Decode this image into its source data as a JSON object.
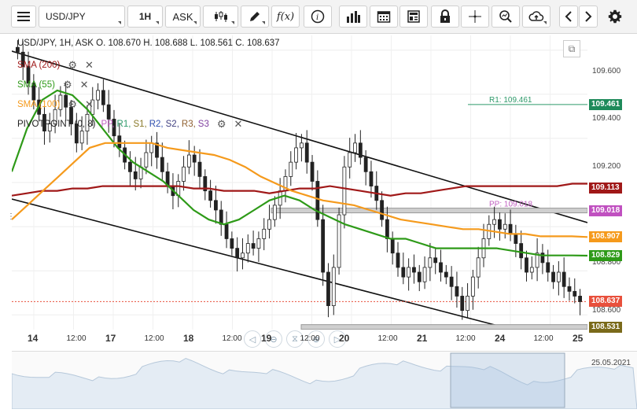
{
  "toolbar": {
    "menu_icon": "hamburger-icon",
    "symbol": "USD/JPY",
    "timeframe": "1H",
    "price_type": "ASK",
    "buttons": [
      "candles-icon",
      "draw-pencil-icon",
      "function-icon",
      "info-icon",
      "volume-bars-icon",
      "calendar-icon",
      "news-icon",
      "lock-icon",
      "crosshair-icon",
      "zoom-icon",
      "cloud-upload-icon",
      "prev-arrow-icon",
      "next-arrow-icon",
      "settings-gear-icon"
    ]
  },
  "legend": {
    "header": "USD/JPY, 1H, ASK   O. 108.670 H. 108.688 L. 108.561 C. 108.637",
    "indicators": [
      {
        "label": "SMA (200)",
        "color": "#a01818"
      },
      {
        "label": "SMA (55)",
        "color": "#2e9a18"
      },
      {
        "label": "SMA (100)",
        "color": "#f59a1c"
      }
    ],
    "pivot": {
      "prefix": "PIVOTPOINT (0, 8)",
      "words": [
        {
          "text": "PP,",
          "color": "#c060c0"
        },
        {
          "text": "R1,",
          "color": "#2e9a6a"
        },
        {
          "text": "S1,",
          "color": "#8a7a2a"
        },
        {
          "text": "R2,",
          "color": "#3050b0"
        },
        {
          "text": "S2,",
          "color": "#404080"
        },
        {
          "text": "R3,",
          "color": "#906030"
        },
        {
          "text": "S3",
          "color": "#8040a0"
        }
      ]
    }
  },
  "y_axis": {
    "ticks": [
      "109.600",
      "109.400",
      "109.200",
      "108.800",
      "108.600"
    ]
  },
  "price_tags": [
    {
      "label": "109.461",
      "color": "#1e8a5a",
      "price": 109.461
    },
    {
      "label": "109.113",
      "color": "#a01818",
      "price": 109.113
    },
    {
      "label": "109.018",
      "color": "#c050c0",
      "price": 109.018
    },
    {
      "label": "108.907",
      "color": "#f59a1c",
      "price": 108.907
    },
    {
      "label": "108.829",
      "color": "#2e9a18",
      "price": 108.829
    },
    {
      "label": "108.637",
      "color": "#e8503c",
      "price": 108.637
    },
    {
      "label": "108.531",
      "color": "#7a6a1a",
      "price": 108.531
    }
  ],
  "line_labels": {
    "r1": "R1: 109.461",
    "pp": "PP: 109.018",
    "s1": "S1: 108.531"
  },
  "x_axis": {
    "labels": [
      {
        "text": "14",
        "big": true
      },
      {
        "text": "12:00",
        "big": false
      },
      {
        "text": "17",
        "big": true
      },
      {
        "text": "12:00",
        "big": false
      },
      {
        "text": "18",
        "big": true
      },
      {
        "text": "12:00",
        "big": false
      },
      {
        "text": "19",
        "big": true
      },
      {
        "text": "12:00",
        "big": false
      },
      {
        "text": "20",
        "big": true
      },
      {
        "text": "12:00",
        "big": false
      },
      {
        "text": "21",
        "big": true
      },
      {
        "text": "12:00",
        "big": false
      },
      {
        "text": "24",
        "big": true
      },
      {
        "text": "12:00",
        "big": false
      },
      {
        "text": "25",
        "big": true
      }
    ],
    "end_date": "25.05.2021"
  },
  "chart_data": {
    "type": "candlestick",
    "instrument": "USD/JPY",
    "timeframe": "1H",
    "ohlc_last": {
      "open": 108.67,
      "high": 108.688,
      "low": 108.561,
      "close": 108.637
    },
    "closes": [
      109.68,
      109.62,
      109.55,
      109.48,
      109.42,
      109.35,
      109.38,
      109.44,
      109.5,
      109.45,
      109.38,
      109.3,
      109.35,
      109.42,
      109.48,
      109.52,
      109.46,
      109.4,
      109.33,
      109.28,
      109.22,
      109.18,
      109.15,
      109.2,
      109.26,
      109.3,
      109.24,
      109.18,
      109.12,
      109.08,
      109.14,
      109.2,
      109.25,
      109.22,
      109.16,
      109.1,
      109.06,
      109.02,
      108.96,
      108.9,
      108.86,
      108.82,
      108.84,
      108.88,
      108.86,
      108.9,
      108.94,
      108.98,
      109.04,
      109.1,
      109.16,
      109.22,
      109.28,
      109.3,
      109.22,
      109.14,
      108.98,
      108.76,
      108.62,
      108.78,
      109.0,
      109.2,
      109.26,
      109.3,
      109.24,
      109.18,
      109.12,
      109.06,
      108.98,
      108.9,
      108.84,
      108.78,
      108.74,
      108.78,
      108.76,
      108.72,
      108.78,
      108.82,
      108.8,
      108.76,
      108.74,
      108.7,
      108.66,
      108.6,
      108.66,
      108.74,
      108.82,
      108.9,
      108.96,
      108.98,
      108.94,
      108.96,
      108.92,
      108.88,
      108.82,
      108.76,
      108.78,
      108.84,
      108.8,
      108.76,
      108.72,
      108.76,
      108.7,
      108.68,
      108.66,
      108.637
    ],
    "sma200": [
      109.08,
      109.09,
      109.1,
      109.1,
      109.11,
      109.11,
      109.12,
      109.12,
      109.12,
      109.12,
      109.12,
      109.12,
      109.11,
      109.11,
      109.1,
      109.1,
      109.1,
      109.09,
      109.1,
      109.11,
      109.11,
      109.12,
      109.11,
      109.1,
      109.09,
      109.08,
      109.09,
      109.09,
      109.1,
      109.11,
      109.12,
      109.12,
      109.12,
      109.12,
      109.12,
      109.12,
      109.12,
      109.13,
      109.13
    ],
    "sma55": [
      109.18,
      109.36,
      109.48,
      109.52,
      109.5,
      109.44,
      109.36,
      109.28,
      109.22,
      109.18,
      109.14,
      109.08,
      109.02,
      108.98,
      108.96,
      108.98,
      109.02,
      109.06,
      109.08,
      109.06,
      109.02,
      108.99,
      108.96,
      108.94,
      108.92,
      108.9,
      108.9,
      108.88,
      108.86,
      108.86,
      108.86,
      108.86,
      108.86,
      108.85,
      108.84,
      108.83,
      108.83,
      108.83,
      108.829
    ],
    "sma100": [
      108.98,
      109.04,
      109.1,
      109.16,
      109.22,
      109.28,
      109.3,
      109.3,
      109.3,
      109.3,
      109.28,
      109.27,
      109.26,
      109.25,
      109.23,
      109.2,
      109.16,
      109.13,
      109.1,
      109.08,
      109.06,
      109.05,
      109.04,
      109.02,
      109.0,
      108.98,
      108.97,
      108.96,
      108.95,
      108.94,
      108.94,
      108.93,
      108.92,
      108.92,
      108.91,
      108.91,
      108.91,
      108.907
    ],
    "pivot": {
      "R1": 109.461,
      "PP": 109.018,
      "S1": 108.531
    },
    "y_range": [
      108.52,
      109.75
    ],
    "grid": true
  }
}
